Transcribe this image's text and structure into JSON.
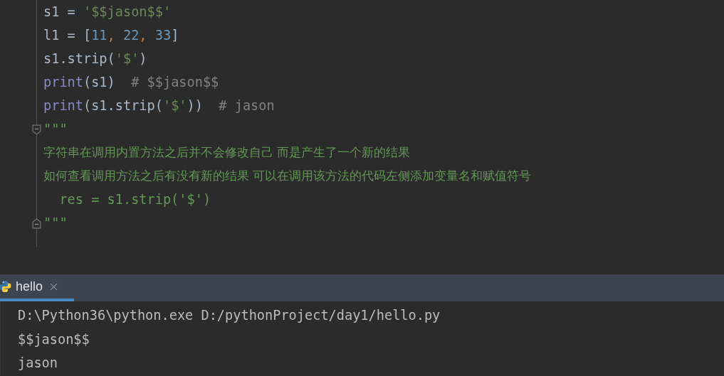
{
  "editor": {
    "lines": [
      {
        "tokens": [
          {
            "kind": "plain",
            "text": "s1 = "
          },
          {
            "kind": "string",
            "text": "'$$jason$$'"
          }
        ]
      },
      {
        "tokens": [
          {
            "kind": "plain",
            "text": "l1 = ["
          },
          {
            "kind": "number",
            "text": "11"
          },
          {
            "kind": "punct",
            "text": ", "
          },
          {
            "kind": "number",
            "text": "22"
          },
          {
            "kind": "punct",
            "text": ", "
          },
          {
            "kind": "number",
            "text": "33"
          },
          {
            "kind": "plain",
            "text": "]"
          }
        ]
      },
      {
        "tokens": [
          {
            "kind": "plain",
            "text": "s1.strip("
          },
          {
            "kind": "string",
            "text": "'$'"
          },
          {
            "kind": "plain",
            "text": ")"
          }
        ]
      },
      {
        "tokens": [
          {
            "kind": "builtin",
            "text": "print"
          },
          {
            "kind": "plain",
            "text": "(s1)  "
          },
          {
            "kind": "comment",
            "text": "# $$jason$$"
          }
        ]
      },
      {
        "tokens": [
          {
            "kind": "builtin",
            "text": "print"
          },
          {
            "kind": "plain",
            "text": "(s1.strip("
          },
          {
            "kind": "string",
            "text": "'$'"
          },
          {
            "kind": "plain",
            "text": "))  "
          },
          {
            "kind": "comment",
            "text": "# jason"
          }
        ]
      },
      {
        "fold_start": true,
        "tokens": [
          {
            "kind": "docstring",
            "text": "\"\"\""
          }
        ]
      },
      {
        "tokens": [
          {
            "kind": "docstring-cjk",
            "text": "字符串在调用内置方法之后并不会修改自己 而是产生了一个新的结果"
          }
        ]
      },
      {
        "tokens": [
          {
            "kind": "docstring-cjk",
            "text": "如何查看调用方法之后有没有新的结果 可以在调用该方法的代码左侧添加变量名和赋值符号"
          }
        ]
      },
      {
        "tokens": [
          {
            "kind": "docstring",
            "text": "  res = s1.strip('$')"
          }
        ]
      },
      {
        "fold_end": true,
        "tokens": [
          {
            "kind": "docstring",
            "text": "\"\"\""
          }
        ]
      }
    ]
  },
  "run_panel": {
    "tabs": [
      {
        "label": "hello",
        "selected": true
      }
    ],
    "output": [
      "D:\\Python36\\python.exe D:/pythonProject/day1/hello.py",
      "$$jason$$",
      "jason"
    ]
  }
}
